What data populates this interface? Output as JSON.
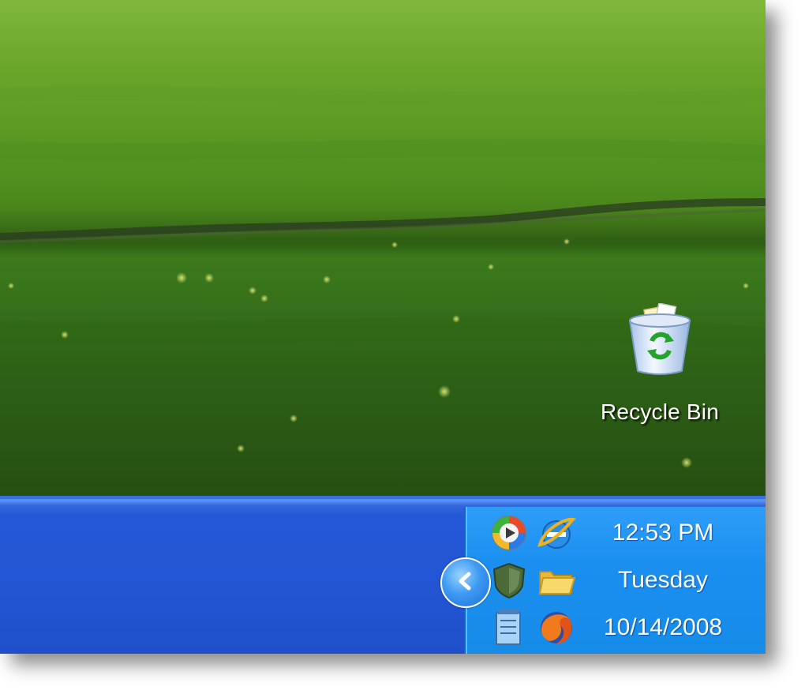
{
  "desktop": {
    "icons": [
      {
        "label": "Recycle Bin",
        "icon": "recycle-bin-icon"
      }
    ]
  },
  "taskbar": {
    "tray": {
      "expand_icon": "chevron-left-icon",
      "icons": [
        {
          "name": "windows-media-player-icon"
        },
        {
          "name": "internet-explorer-icon"
        },
        {
          "name": "security-shield-icon"
        },
        {
          "name": "folder-icon"
        },
        {
          "name": "notepad-icon"
        },
        {
          "name": "firefox-icon"
        }
      ],
      "clock": {
        "time": "12:53 PM",
        "day": "Tuesday",
        "date": "10/14/2008"
      }
    }
  },
  "colors": {
    "taskbar": "#2355d3",
    "tray": "#1a8ff0"
  }
}
